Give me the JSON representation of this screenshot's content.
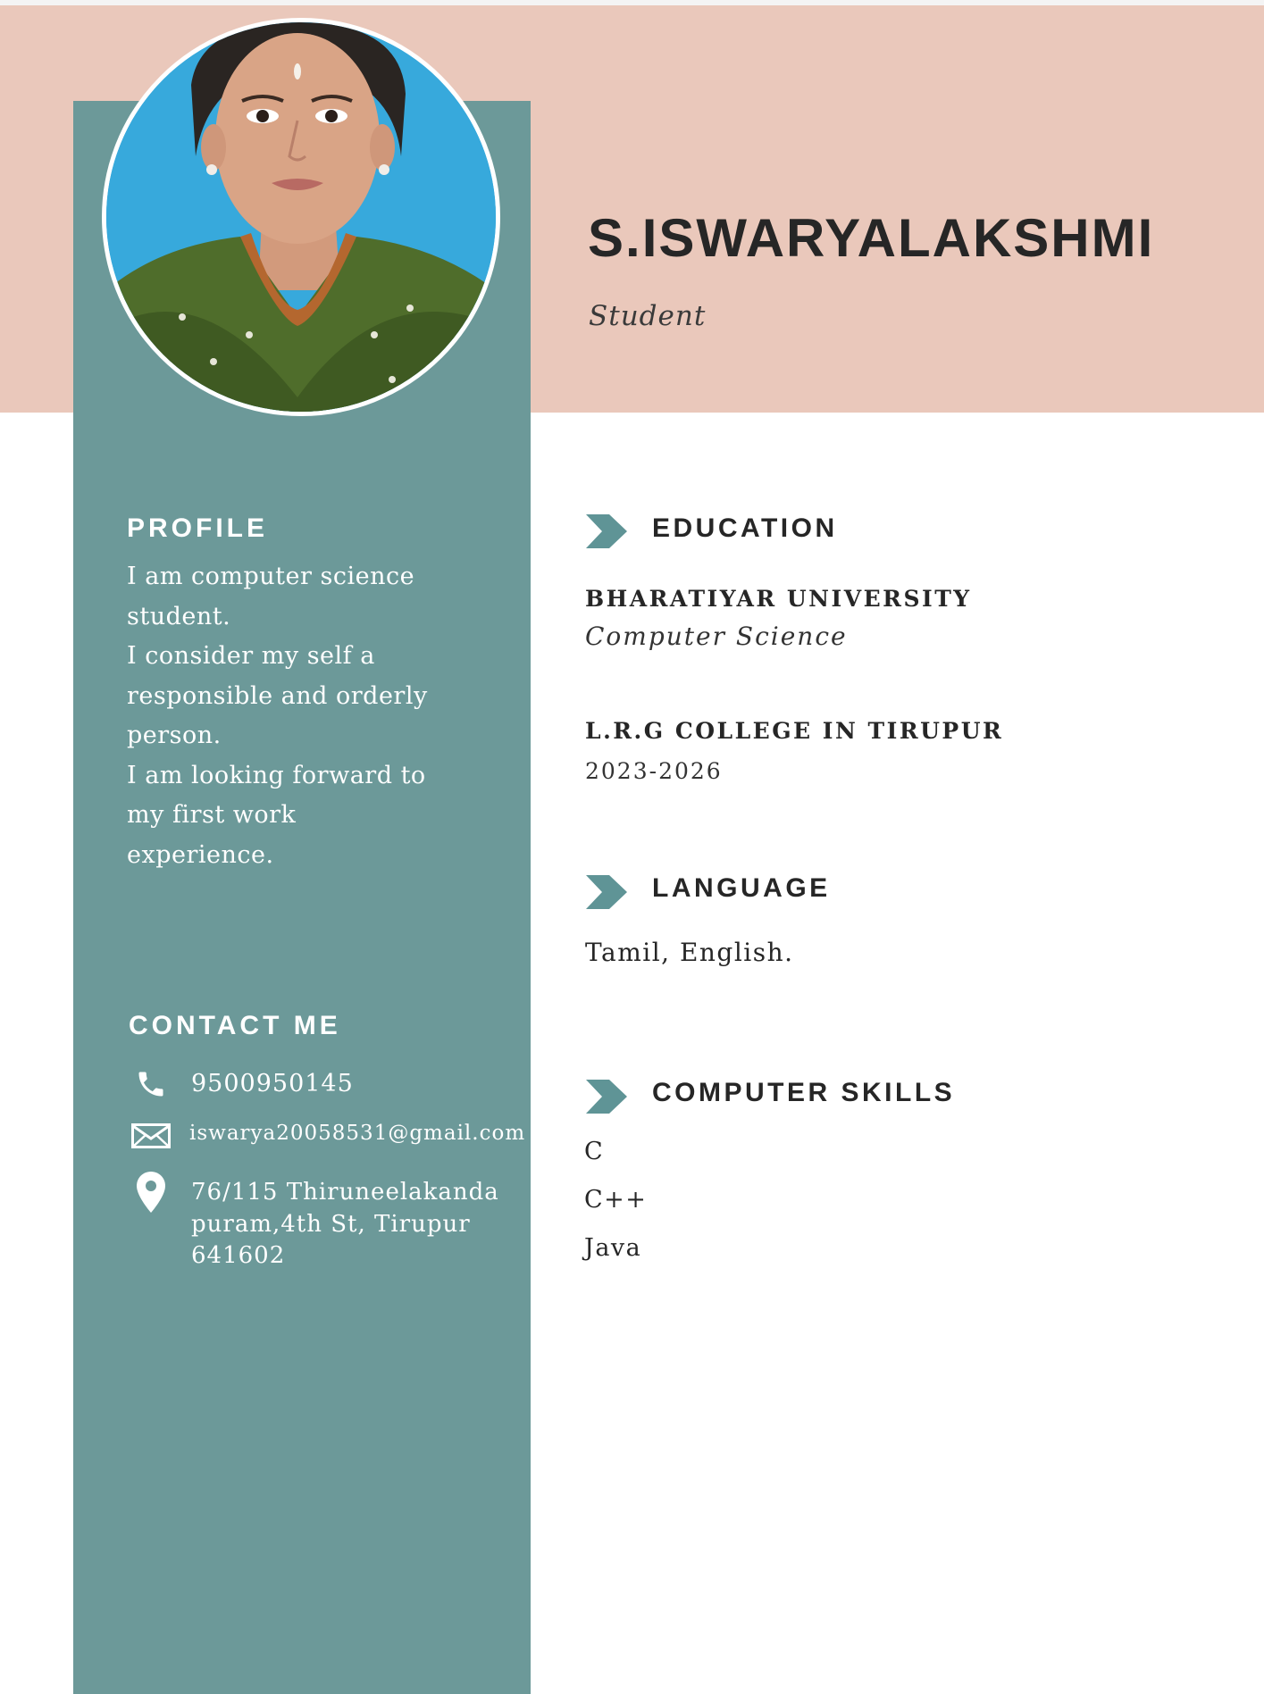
{
  "colors": {
    "header_band": "#eac8bb",
    "sidebar": "#6c9999",
    "accent_chevron": "#5f9496",
    "heading_text": "#262626"
  },
  "header": {
    "name": "S.ISWARYALAKSHMI",
    "role": "Student"
  },
  "profile": {
    "heading": "PROFILE",
    "lines": [
      "I am computer science",
      "student.",
      "I consider my self a",
      "responsible and orderly",
      "person.",
      "I am looking forward to",
      "my first work",
      "experience."
    ]
  },
  "contact": {
    "heading": "CONTACT ME",
    "phone": "9500950145",
    "email": "iswarya20058531@gmail.com",
    "address_lines": [
      "76/115 Thiruneelakanda",
      "puram,4th St, Tirupur",
      "641602"
    ],
    "icons": [
      "phone-icon",
      "mail-icon",
      "location-pin-icon"
    ]
  },
  "education": {
    "heading": "EDUCATION",
    "entries": [
      {
        "title": "BHARATIYAR UNIVERSITY",
        "detail": "Computer Science"
      },
      {
        "title": "L.R.G COLLEGE IN TIRUPUR",
        "detail": "2023-2026"
      }
    ]
  },
  "language": {
    "heading": "LANGUAGE",
    "text": "Tamil, English."
  },
  "skills": {
    "heading": "COMPUTER SKILLS",
    "items": [
      "C",
      "C++",
      "Java"
    ]
  }
}
